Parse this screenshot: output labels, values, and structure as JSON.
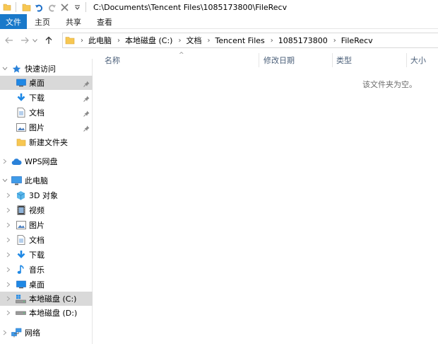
{
  "window": {
    "title_path": "C:\\Documents\\Tencent Files\\1085173800\\FileRecv"
  },
  "ribbon": {
    "tabs": [
      {
        "label": "文件",
        "active": true
      },
      {
        "label": "主页"
      },
      {
        "label": "共享"
      },
      {
        "label": "查看"
      }
    ]
  },
  "address": {
    "crumbs": [
      "此电脑",
      "本地磁盘 (C:)",
      "文档",
      "Tencent Files",
      "1085173800",
      "FileRecv"
    ]
  },
  "sidebar": {
    "quick_access": {
      "label": "快速访问",
      "items": [
        {
          "label": "桌面",
          "icon": "desktop-icon",
          "pinned": true
        },
        {
          "label": "下载",
          "icon": "download-icon",
          "pinned": true
        },
        {
          "label": "文档",
          "icon": "document-icon",
          "pinned": true
        },
        {
          "label": "图片",
          "icon": "pictures-icon",
          "pinned": true
        },
        {
          "label": "新建文件夹",
          "icon": "folder-icon",
          "pinned": false
        }
      ]
    },
    "wps": {
      "label": "WPS网盘",
      "icon": "cloud-icon"
    },
    "this_pc": {
      "label": "此电脑",
      "items": [
        {
          "label": "3D 对象",
          "icon": "3d-objects-icon"
        },
        {
          "label": "视频",
          "icon": "video-icon"
        },
        {
          "label": "图片",
          "icon": "pictures-icon"
        },
        {
          "label": "文档",
          "icon": "document-icon"
        },
        {
          "label": "下载",
          "icon": "download-icon"
        },
        {
          "label": "音乐",
          "icon": "music-icon"
        },
        {
          "label": "桌面",
          "icon": "desktop-icon"
        },
        {
          "label": "本地磁盘 (C:)",
          "icon": "windows-drive-icon",
          "selected": true
        },
        {
          "label": "本地磁盘 (D:)",
          "icon": "drive-icon"
        }
      ]
    },
    "network": {
      "label": "网络",
      "icon": "network-icon"
    }
  },
  "columns": {
    "name": "名称",
    "date": "修改日期",
    "type": "类型",
    "size": "大小"
  },
  "empty_message": "该文件夹为空。",
  "colors": {
    "file_tab": "#1979ca",
    "selected": "#d9d9d9",
    "folder": "#f7c752",
    "accent_blue": "#1e88e5"
  }
}
